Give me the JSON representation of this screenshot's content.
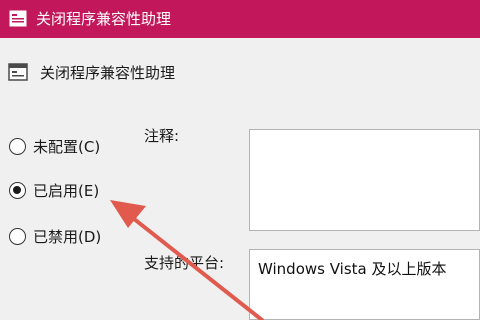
{
  "window": {
    "title": "关闭程序兼容性助理"
  },
  "header": {
    "title": "关闭程序兼容性助理"
  },
  "options": [
    {
      "label": "未配置(C)",
      "checked": false
    },
    {
      "label": "已启用(E)",
      "checked": true
    },
    {
      "label": "已禁用(D)",
      "checked": false
    }
  ],
  "comment": {
    "label": "注释:",
    "value": ""
  },
  "platform": {
    "label": "支持的平台:",
    "value": "Windows Vista 及以上版本"
  },
  "colors": {
    "titlebar": "#c2185b",
    "annotation_arrow": "#e05a4e"
  }
}
